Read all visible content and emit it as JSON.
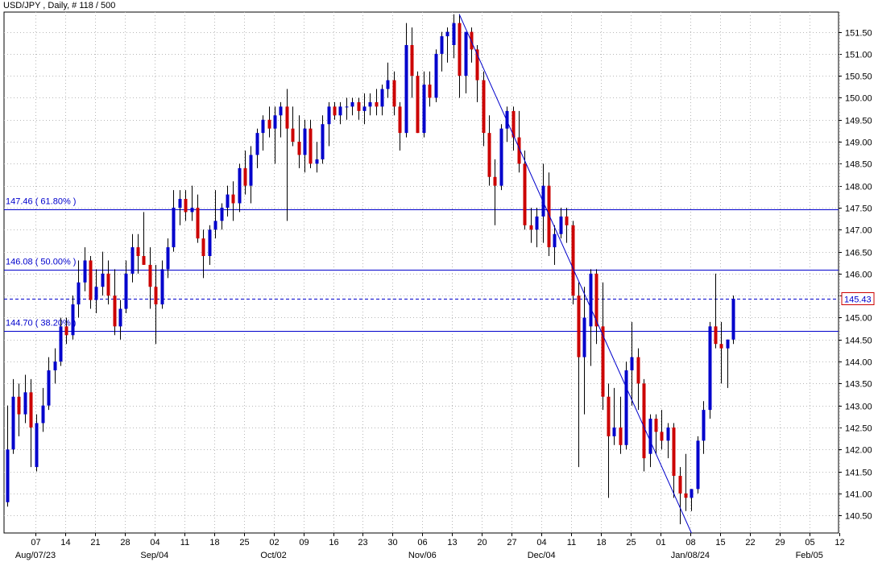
{
  "chart_data": {
    "type": "candlestick",
    "title": "USD/JPY , Daily, # 118 / 500",
    "ylim": [
      140.1,
      151.95
    ],
    "y_ticks": [
      140.5,
      141.0,
      141.5,
      142.0,
      142.5,
      143.0,
      143.5,
      144.0,
      144.5,
      145.0,
      145.5,
      146.0,
      146.5,
      147.0,
      147.5,
      148.0,
      148.5,
      149.0,
      149.5,
      150.0,
      150.5,
      151.0,
      151.5
    ],
    "y_tick_labels": [
      "140.50",
      "141.00",
      "141.50",
      "142.00",
      "142.50",
      "143.00",
      "143.50",
      "144.00",
      "144.50",
      "145.00",
      "145.50",
      "146.00",
      "146.50",
      "147.00",
      "147.50",
      "148.00",
      "148.50",
      "149.00",
      "149.50",
      "150.00",
      "150.50",
      "151.00",
      "151.50"
    ],
    "x_ticks": [
      "07",
      "14",
      "21",
      "28",
      "04",
      "11",
      "18",
      "25",
      "02",
      "09",
      "16",
      "23",
      "30",
      "06",
      "13",
      "20",
      "27",
      "04",
      "11",
      "18",
      "25",
      "01",
      "08",
      "15",
      "22",
      "29",
      "05",
      "12"
    ],
    "x_month_labels": [
      {
        "label": "Aug/07/23",
        "tick": 0
      },
      {
        "label": "Sep/04",
        "tick": 4
      },
      {
        "label": "Oct/02",
        "tick": 8
      },
      {
        "label": "Nov/06",
        "tick": 13
      },
      {
        "label": "Dec/04",
        "tick": 17
      },
      {
        "label": "Jan/08/24",
        "tick": 22
      },
      {
        "label": "Feb/05",
        "tick": 26
      }
    ],
    "last_price": 145.43,
    "last_price_label": "145.43",
    "fib_levels": [
      {
        "value": 147.46,
        "label": "147.46 ( 61.80% )"
      },
      {
        "value": 146.08,
        "label": "146.08 ( 50.00% )"
      },
      {
        "value": 144.7,
        "label": "144.70 ( 38.20% )"
      }
    ],
    "trendline": {
      "from_index": 76,
      "from_value": 151.9,
      "to_index": 115,
      "to_value": 140.1
    },
    "colors": {
      "up": "#0000cc",
      "down": "#cc0000",
      "lines": "#0000cc"
    },
    "candles": [
      [
        140.8,
        143.0,
        140.7,
        142.0
      ],
      [
        142.0,
        143.6,
        141.9,
        143.2
      ],
      [
        143.2,
        143.5,
        142.3,
        142.8
      ],
      [
        142.8,
        143.7,
        142.6,
        143.3
      ],
      [
        143.3,
        143.6,
        141.6,
        142.5
      ],
      [
        141.6,
        142.8,
        141.5,
        142.6
      ],
      [
        142.6,
        143.4,
        142.4,
        143.0
      ],
      [
        143.0,
        144.1,
        142.9,
        143.8
      ],
      [
        143.8,
        144.3,
        143.5,
        144.0
      ],
      [
        144.0,
        145.0,
        143.9,
        144.8
      ],
      [
        144.8,
        145.0,
        144.4,
        144.6
      ],
      [
        144.6,
        145.5,
        144.5,
        145.3
      ],
      [
        145.3,
        146.3,
        145.0,
        145.8
      ],
      [
        145.8,
        146.6,
        145.6,
        146.3
      ],
      [
        146.3,
        146.4,
        145.2,
        145.4
      ],
      [
        145.4,
        146.1,
        145.1,
        145.7
      ],
      [
        145.7,
        146.5,
        145.5,
        146.0
      ],
      [
        146.0,
        146.3,
        145.3,
        145.5
      ],
      [
        145.5,
        146.1,
        144.6,
        144.8
      ],
      [
        144.8,
        145.4,
        144.5,
        145.2
      ],
      [
        145.2,
        146.3,
        145.1,
        146.0
      ],
      [
        146.0,
        146.9,
        145.8,
        146.6
      ],
      [
        146.6,
        146.9,
        146.0,
        146.4
      ],
      [
        146.4,
        147.4,
        146.2,
        146.2
      ],
      [
        146.2,
        146.6,
        145.2,
        145.7
      ],
      [
        145.7,
        146.2,
        144.4,
        145.3
      ],
      [
        145.3,
        146.3,
        145.2,
        146.1
      ],
      [
        146.1,
        146.8,
        145.9,
        146.6
      ],
      [
        146.6,
        147.9,
        146.5,
        147.5
      ],
      [
        147.5,
        147.9,
        147.1,
        147.7
      ],
      [
        147.7,
        147.9,
        147.2,
        147.4
      ],
      [
        147.4,
        148.0,
        147.2,
        147.5
      ],
      [
        147.5,
        147.8,
        146.7,
        146.8
      ],
      [
        146.8,
        147.0,
        145.9,
        146.4
      ],
      [
        146.4,
        147.1,
        146.2,
        147.0
      ],
      [
        147.0,
        147.9,
        146.8,
        147.2
      ],
      [
        147.2,
        147.6,
        147.0,
        147.5
      ],
      [
        147.5,
        148.0,
        147.3,
        147.8
      ],
      [
        147.8,
        148.1,
        147.2,
        147.6
      ],
      [
        147.6,
        148.5,
        147.4,
        148.4
      ],
      [
        148.4,
        148.8,
        147.8,
        148.0
      ],
      [
        148.0,
        148.9,
        147.6,
        148.7
      ],
      [
        148.7,
        149.3,
        148.4,
        149.2
      ],
      [
        149.2,
        149.6,
        148.8,
        149.5
      ],
      [
        149.5,
        149.8,
        149.1,
        149.3
      ],
      [
        149.3,
        149.8,
        148.5,
        149.6
      ],
      [
        149.6,
        149.9,
        149.1,
        149.8
      ],
      [
        149.8,
        150.2,
        147.2,
        149.3
      ],
      [
        149.3,
        149.8,
        148.9,
        149.0
      ],
      [
        149.0,
        149.6,
        148.4,
        148.7
      ],
      [
        148.7,
        149.5,
        148.3,
        149.3
      ],
      [
        149.3,
        149.5,
        148.4,
        148.5
      ],
      [
        148.5,
        149.0,
        148.3,
        148.6
      ],
      [
        148.6,
        149.6,
        148.5,
        149.4
      ],
      [
        149.4,
        149.9,
        148.9,
        149.8
      ],
      [
        149.8,
        149.9,
        149.5,
        149.6
      ],
      [
        149.6,
        149.9,
        149.4,
        149.8
      ],
      [
        149.8,
        150.0,
        149.5,
        149.8
      ],
      [
        149.8,
        150.0,
        149.6,
        149.9
      ],
      [
        149.9,
        150.0,
        149.5,
        149.7
      ],
      [
        149.7,
        150.1,
        149.4,
        149.8
      ],
      [
        149.8,
        150.1,
        149.6,
        149.9
      ],
      [
        149.9,
        150.2,
        149.6,
        149.8
      ],
      [
        149.8,
        150.3,
        149.6,
        150.2
      ],
      [
        150.2,
        150.8,
        150.0,
        150.4
      ],
      [
        150.4,
        150.6,
        149.6,
        149.8
      ],
      [
        149.8,
        149.9,
        148.8,
        149.2
      ],
      [
        149.2,
        151.7,
        149.1,
        151.2
      ],
      [
        151.2,
        151.6,
        150.0,
        150.5
      ],
      [
        150.5,
        150.6,
        149.2,
        149.2
      ],
      [
        149.2,
        150.6,
        149.1,
        150.3
      ],
      [
        150.3,
        150.6,
        149.8,
        150.0
      ],
      [
        150.0,
        151.1,
        149.9,
        151.0
      ],
      [
        151.0,
        151.5,
        150.6,
        151.4
      ],
      [
        151.4,
        151.6,
        150.8,
        151.5
      ],
      [
        151.2,
        151.9,
        150.9,
        151.7
      ],
      [
        151.7,
        151.9,
        150.0,
        150.5
      ],
      [
        150.5,
        151.0,
        150.1,
        151.5
      ],
      [
        151.5,
        151.6,
        150.8,
        151.1
      ],
      [
        151.1,
        151.2,
        149.9,
        150.4
      ],
      [
        150.4,
        150.6,
        148.9,
        149.2
      ],
      [
        149.2,
        149.6,
        148.0,
        148.2
      ],
      [
        148.2,
        148.6,
        147.1,
        148.0
      ],
      [
        148.0,
        149.4,
        147.9,
        149.3
      ],
      [
        149.3,
        149.8,
        149.0,
        149.7
      ],
      [
        149.7,
        149.8,
        148.8,
        149.1
      ],
      [
        149.1,
        149.7,
        148.3,
        148.5
      ],
      [
        148.5,
        148.8,
        147.0,
        147.1
      ],
      [
        147.1,
        147.5,
        146.7,
        147.0
      ],
      [
        147.0,
        147.5,
        146.6,
        147.3
      ],
      [
        147.3,
        148.5,
        146.7,
        148.0
      ],
      [
        148.0,
        148.3,
        146.4,
        146.6
      ],
      [
        146.6,
        147.1,
        146.2,
        146.9
      ],
      [
        146.9,
        147.5,
        146.8,
        147.3
      ],
      [
        147.3,
        147.5,
        146.7,
        147.1
      ],
      [
        147.1,
        147.2,
        145.3,
        145.5
      ],
      [
        145.5,
        145.8,
        141.6,
        144.1
      ],
      [
        144.1,
        145.7,
        142.8,
        145.0
      ],
      [
        144.8,
        146.1,
        143.9,
        146.0
      ],
      [
        146.0,
        146.1,
        144.4,
        144.8
      ],
      [
        144.8,
        145.8,
        142.9,
        143.2
      ],
      [
        143.2,
        143.5,
        140.9,
        142.3
      ],
      [
        142.3,
        143.4,
        142.1,
        142.5
      ],
      [
        142.5,
        143.2,
        141.9,
        142.1
      ],
      [
        142.1,
        144.0,
        142.0,
        143.8
      ],
      [
        143.8,
        144.9,
        143.0,
        144.1
      ],
      [
        144.1,
        144.3,
        142.9,
        143.5
      ],
      [
        143.5,
        143.6,
        141.5,
        141.8
      ],
      [
        141.9,
        142.8,
        141.6,
        142.7
      ],
      [
        142.7,
        142.8,
        141.9,
        142.4
      ],
      [
        142.4,
        142.9,
        142.0,
        142.2
      ],
      [
        142.2,
        142.6,
        141.8,
        142.5
      ],
      [
        142.5,
        142.6,
        140.9,
        141.4
      ],
      [
        141.4,
        141.6,
        140.3,
        141.0
      ],
      [
        141.0,
        141.9,
        140.6,
        140.9
      ],
      [
        140.9,
        141.1,
        140.6,
        141.1
      ],
      [
        141.1,
        142.3,
        141.0,
        142.2
      ],
      [
        142.2,
        143.1,
        141.9,
        142.9
      ],
      [
        142.9,
        144.9,
        142.7,
        144.8
      ],
      [
        144.8,
        146.0,
        144.3,
        144.4
      ],
      [
        144.4,
        144.9,
        143.5,
        144.3
      ],
      [
        144.3,
        144.5,
        143.4,
        144.5
      ],
      [
        144.5,
        145.5,
        144.4,
        145.43
      ]
    ]
  }
}
